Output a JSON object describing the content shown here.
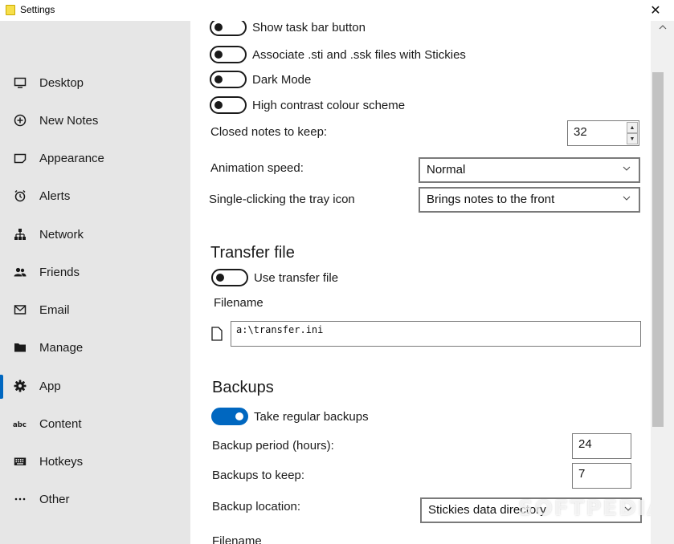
{
  "window": {
    "title": "Settings",
    "close_glyph": "✕"
  },
  "sidebar": {
    "items": [
      {
        "label": "Desktop",
        "icon": "monitor-icon"
      },
      {
        "label": "New Notes",
        "icon": "plus-circle-icon"
      },
      {
        "label": "Appearance",
        "icon": "note-icon"
      },
      {
        "label": "Alerts",
        "icon": "alarm-clock-icon"
      },
      {
        "label": "Network",
        "icon": "network-icon"
      },
      {
        "label": "Friends",
        "icon": "people-icon"
      },
      {
        "label": "Email",
        "icon": "mail-icon"
      },
      {
        "label": "Manage",
        "icon": "folder-icon"
      },
      {
        "label": "App",
        "icon": "gear-icon",
        "selected": true
      },
      {
        "label": "Content",
        "icon": "abc-icon"
      },
      {
        "label": "Hotkeys",
        "icon": "keyboard-icon"
      },
      {
        "label": "Other",
        "icon": "more-icon"
      }
    ]
  },
  "app": {
    "toggles": [
      {
        "label": "Show task bar button",
        "on": false
      },
      {
        "label": "Associate .sti and .ssk files with Stickies",
        "on": false
      },
      {
        "label": "Dark Mode",
        "on": false
      },
      {
        "label": "High contrast colour scheme",
        "on": false
      }
    ],
    "closed_notes": {
      "label": "Closed notes to keep:",
      "value": "32"
    },
    "animation_speed": {
      "label": "Animation speed:",
      "value": "Normal"
    },
    "tray_click": {
      "label": "Single-clicking the tray icon",
      "value": "Brings notes to the front"
    }
  },
  "transfer": {
    "heading": "Transfer file",
    "toggle_label": "Use transfer file",
    "toggle_on": false,
    "filename_label": "Filename",
    "filename_value": "a:\\transfer.ini"
  },
  "backups": {
    "heading": "Backups",
    "toggle_label": "Take regular backups",
    "toggle_on": true,
    "period": {
      "label": "Backup period (hours):",
      "value": "24"
    },
    "keep": {
      "label": "Backups to keep:",
      "value": "7"
    },
    "location": {
      "label": "Backup location:",
      "value": "Stickies data directory"
    },
    "filename_label": "Filename"
  },
  "watermark": "SOFTPEDIA",
  "colors": {
    "accent": "#0067c0",
    "sidebar_bg": "#e6e6e6",
    "scroll_thumb": "#c2c2c2"
  }
}
